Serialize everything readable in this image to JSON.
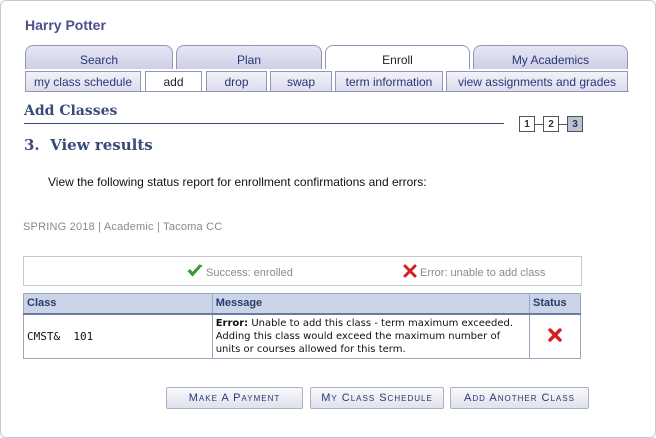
{
  "student": {
    "name": "Harry Potter"
  },
  "main_tabs": [
    {
      "label": "Search",
      "active": false
    },
    {
      "label": "Plan",
      "active": false
    },
    {
      "label": "Enroll",
      "active": true
    },
    {
      "label": "My Academics",
      "active": false
    }
  ],
  "sub_tabs": [
    {
      "label": "my class schedule",
      "active": false
    },
    {
      "label": "add",
      "active": true
    },
    {
      "label": "drop",
      "active": false
    },
    {
      "label": "swap",
      "active": false
    },
    {
      "label": "term information",
      "active": false
    },
    {
      "label": "view assignments and grades",
      "active": false
    }
  ],
  "page": {
    "title": "Add Classes",
    "steps": [
      "1",
      "2",
      "3"
    ],
    "current_step": "3",
    "step_heading": "3.  View results",
    "instructions": "View the following status report for enrollment confirmations and errors:",
    "term_info": "SPRING 2018 | Academic | Tacoma CC"
  },
  "legend": {
    "success_label": "Success: enrolled",
    "error_label": "Error: unable to add class",
    "success_icon": "checkmark-icon",
    "error_icon": "x-icon",
    "success_color": "#3aa63a",
    "error_color": "#d42020"
  },
  "results_table": {
    "columns": [
      "Class",
      "Message",
      "Status"
    ],
    "rows": [
      {
        "class": "CMST&  101",
        "message_prefix": "Error:",
        "message": " Unable to add this class - term maximum exceeded. Adding this class would exceed the maximum number of units or courses allowed for this term.",
        "status_icon": "x-icon"
      }
    ]
  },
  "buttons": {
    "make_payment": "Make A Payment",
    "my_class_schedule": "My Class Schedule",
    "add_another_class": "Add Another Class"
  }
}
